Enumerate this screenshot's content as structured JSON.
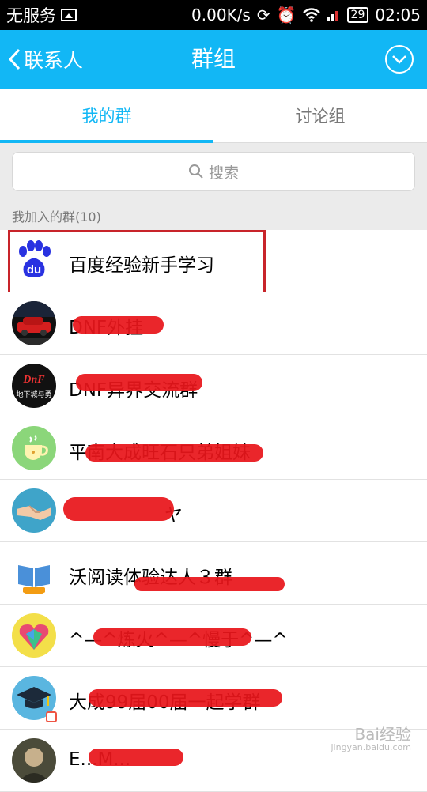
{
  "status_bar": {
    "carrier": "无服务",
    "speed": "0.00K/s",
    "battery": "29",
    "time": "02:05"
  },
  "header": {
    "back_label": "联系人",
    "title": "群组"
  },
  "tabs": [
    {
      "label": "我的群",
      "active": true
    },
    {
      "label": "讨论组",
      "active": false
    }
  ],
  "search": {
    "placeholder": "搜索"
  },
  "section_label": "我加入的群(10)",
  "groups": [
    {
      "name": "百度经验新手学习",
      "avatar": "baidu-logo"
    },
    {
      "name": "DNF外挂",
      "avatar": "red-car"
    },
    {
      "name": "DNF异界交流群",
      "avatar": "dnf-logo"
    },
    {
      "name": "平南大成旺石只弟姐妹",
      "avatar": "coffee-cup"
    },
    {
      "name": "ヤ",
      "avatar": "handshake"
    },
    {
      "name": "沃阅读体验达人３群",
      "avatar": "book-logo"
    },
    {
      "name": "^—^炼火^—^慢于^—^",
      "avatar": "heart-gems"
    },
    {
      "name": "大成99届00届一起学群",
      "avatar": "graduation-cap"
    },
    {
      "name": "E...M...",
      "avatar": "person-photo"
    }
  ],
  "watermark": {
    "text": "Bai经验",
    "url": "jingyan.baidu.com"
  },
  "colors": {
    "accent": "#12b7f5",
    "highlight": "#c8242a"
  }
}
